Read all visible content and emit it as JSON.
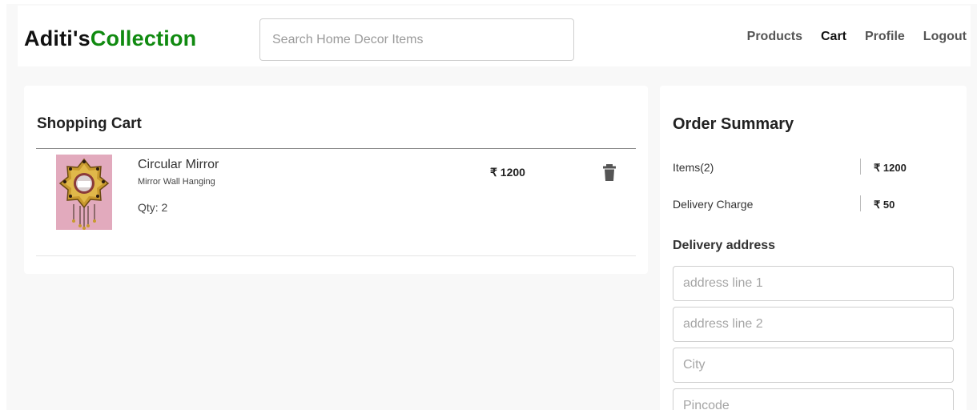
{
  "header": {
    "logo_part1": "Aditi's",
    "logo_part2": "Collection",
    "search_placeholder": "Search Home Decor Items",
    "nav": [
      {
        "label": "Products"
      },
      {
        "label": "Cart"
      },
      {
        "label": "Profile"
      },
      {
        "label": "Logout"
      }
    ]
  },
  "cart": {
    "title": "Shopping Cart",
    "items": [
      {
        "name": "Circular Mirror",
        "description": "Mirror Wall Hanging",
        "qty": "Qty: 2",
        "price": "₹ 1200",
        "image_icon": "mirror-product-image",
        "delete_icon": "trash-icon"
      }
    ]
  },
  "summary": {
    "title": "Order Summary",
    "rows": [
      {
        "label": "Items(2)",
        "value": "₹ 1200"
      },
      {
        "label": "Delivery Charge",
        "value": "₹ 50"
      }
    ],
    "address_title": "Delivery address",
    "address_fields": [
      {
        "placeholder": "address line 1"
      },
      {
        "placeholder": "address line 2"
      },
      {
        "placeholder": "City"
      },
      {
        "placeholder": "Pincode"
      }
    ]
  },
  "colors": {
    "brand_accent": "#108a10",
    "page_bg": "#f8f8f8"
  }
}
